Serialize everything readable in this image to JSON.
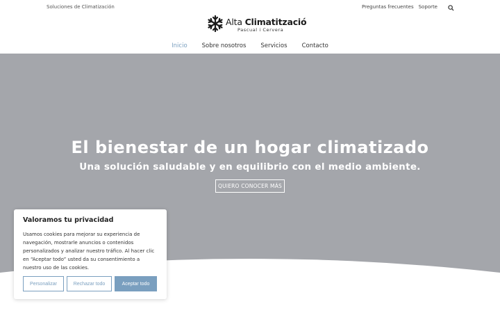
{
  "topbar": {
    "tagline": "Soluciones de Climatización",
    "links": [
      "Preguntas frecuentes",
      "Soporte"
    ]
  },
  "logo": {
    "brand_light": "Alta",
    "brand_bold": "Climatització",
    "subtitle": "Pascual i Cervera"
  },
  "nav": {
    "items": [
      "Inicio",
      "Sobre nosotros",
      "Servicios",
      "Contacto"
    ],
    "active": "Inicio"
  },
  "hero": {
    "title": "El bienestar de un hogar climatizado",
    "subtitle": "Una solución saludable y en equilibrio con el medio ambiente.",
    "cta": "QUIERO CONOCER MÁS",
    "background": "#a4a6ab"
  },
  "cookie": {
    "title": "Valoramos tu privacidad",
    "text": "Usamos cookies para mejorar su experiencia de navegación, mostrarle anuncios o contenidos personalizados y analizar nuestro tráfico. Al hacer clic en “Aceptar todo” usted da su consentimiento a nuestro uso de las cookies.",
    "customize": "Personalizar",
    "reject": "Rechazar todo",
    "accept": "Aceptar todo"
  },
  "colors": {
    "accent": "#7a9fbf"
  }
}
